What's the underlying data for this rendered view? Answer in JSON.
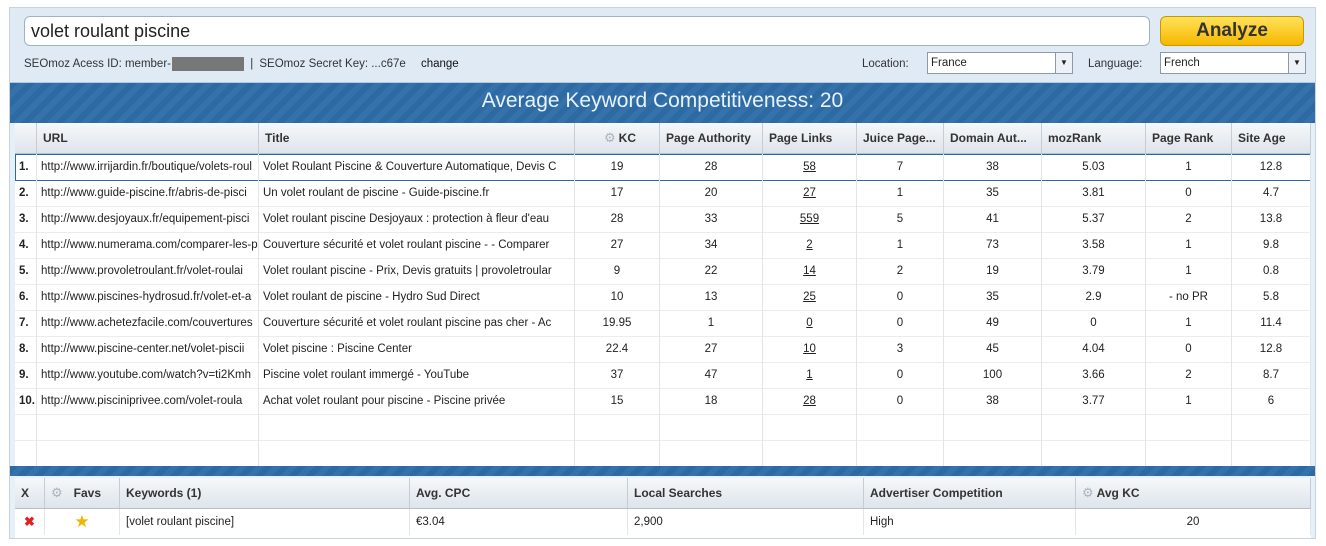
{
  "search": {
    "query": "volet roulant piscine",
    "analyze_label": "Analyze"
  },
  "credentials": {
    "access_id_label": "SEOmoz Acess ID: member-",
    "separator": "|",
    "secret_key_label": "SEOmoz Secret Key: ...c67e",
    "change_label": "change"
  },
  "location": {
    "label": "Location:",
    "value": "France"
  },
  "language": {
    "label": "Language:",
    "value": "French"
  },
  "banner": {
    "title": "Average Keyword Competitiveness: 20"
  },
  "results": {
    "columns": [
      "URL",
      "Title",
      "KC",
      "Page Authority",
      "Page Links",
      "Juice Page...",
      "Domain Aut...",
      "mozRank",
      "Page Rank",
      "Site Age"
    ],
    "rows": [
      {
        "n": "1.",
        "url": "http://www.irrijardin.fr/boutique/volets-roul",
        "title": "Volet Roulant Piscine & Couverture Automatique, Devis C",
        "kc": "19",
        "pa": "28",
        "links": "58",
        "juice": "7",
        "da": "38",
        "moz": "5.03",
        "pr": "1",
        "age": "12.8"
      },
      {
        "n": "2.",
        "url": "http://www.guide-piscine.fr/abris-de-pisci",
        "title": "Un volet roulant de piscine - Guide-piscine.fr",
        "kc": "17",
        "pa": "20",
        "links": "27",
        "juice": "1",
        "da": "35",
        "moz": "3.81",
        "pr": "0",
        "age": "4.7"
      },
      {
        "n": "3.",
        "url": "http://www.desjoyaux.fr/equipement-pisci",
        "title": "Volet roulant piscine Desjoyaux : protection à fleur d'eau",
        "kc": "28",
        "pa": "33",
        "links": "559",
        "juice": "5",
        "da": "41",
        "moz": "5.37",
        "pr": "2",
        "age": "13.8"
      },
      {
        "n": "4.",
        "url": "http://www.numerama.com/comparer-les-p",
        "title": "Couverture sécurité et volet roulant piscine - - Comparer",
        "kc": "27",
        "pa": "34",
        "links": "2",
        "juice": "1",
        "da": "73",
        "moz": "3.58",
        "pr": "1",
        "age": "9.8"
      },
      {
        "n": "5.",
        "url": "http://www.provoletroulant.fr/volet-roulai",
        "title": "Volet roulant piscine - Prix, Devis gratuits | provoletroular",
        "kc": "9",
        "pa": "22",
        "links": "14",
        "juice": "2",
        "da": "19",
        "moz": "3.79",
        "pr": "1",
        "age": "0.8"
      },
      {
        "n": "6.",
        "url": "http://www.piscines-hydrosud.fr/volet-et-a",
        "title": "Volet roulant de piscine - Hydro Sud Direct",
        "kc": "10",
        "pa": "13",
        "links": "25",
        "juice": "0",
        "da": "35",
        "moz": "2.9",
        "pr": "- no PR",
        "age": "5.8"
      },
      {
        "n": "7.",
        "url": "http://www.achetezfacile.com/couvertures",
        "title": "Couverture sécurité et volet roulant piscine pas cher - Ac",
        "kc": "19.95",
        "pa": "1",
        "links": "0",
        "juice": "0",
        "da": "49",
        "moz": "0",
        "pr": "1",
        "age": "11.4"
      },
      {
        "n": "8.",
        "url": "http://www.piscine-center.net/volet-piscii",
        "title": "Volet piscine : Piscine Center",
        "kc": "22.4",
        "pa": "27",
        "links": "10",
        "juice": "3",
        "da": "45",
        "moz": "4.04",
        "pr": "0",
        "age": "12.8"
      },
      {
        "n": "9.",
        "url": "http://www.youtube.com/watch?v=ti2Kmh",
        "title": "Piscine volet roulant immergé - YouTube",
        "kc": "37",
        "pa": "47",
        "links": "1",
        "juice": "0",
        "da": "100",
        "moz": "3.66",
        "pr": "2",
        "age": "8.7"
      },
      {
        "n": "10.",
        "url": "http://www.pisciniprivee.com/volet-roula",
        "title": "Achat volet roulant pour piscine - Piscine privée",
        "kc": "15",
        "pa": "18",
        "links": "28",
        "juice": "0",
        "da": "38",
        "moz": "3.77",
        "pr": "1",
        "age": "6"
      }
    ]
  },
  "keywords": {
    "columns": [
      "X",
      "Favs",
      "Keywords (1)",
      "Avg. CPC",
      "Local Searches",
      "Advertiser Competition",
      "Avg KC"
    ],
    "rows": [
      {
        "keyword": "[volet roulant piscine]",
        "cpc": "€3.04",
        "searches": "2,900",
        "competition": "High",
        "avg_kc": "20"
      }
    ]
  },
  "icons": {
    "delete": "delete-x-icon",
    "favorite": "star-icon",
    "settings": "gear-icon",
    "dropdown": "chevron-down-icon"
  },
  "colors": {
    "banner": "#2d6aa3",
    "analyze": "#f6b800",
    "delete": "#dd2222",
    "star": "#f3b300"
  }
}
